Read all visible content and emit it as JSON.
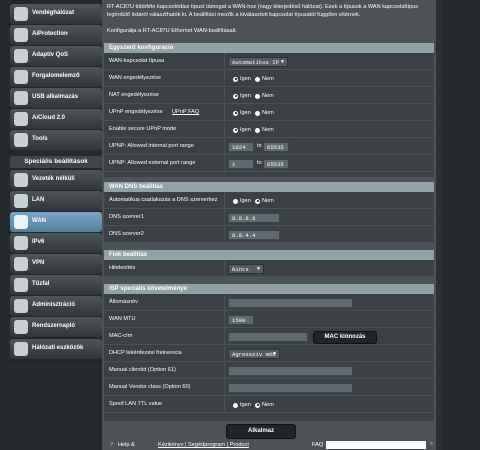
{
  "sidebar": {
    "general_items": [
      {
        "label": "Vendéghálózat",
        "icon": "guest-network-icon"
      },
      {
        "label": "AiProtection",
        "icon": "shield-icon"
      },
      {
        "label": "Adaptív QoS",
        "icon": "qos-icon"
      },
      {
        "label": "Forgalomelemző",
        "icon": "traffic-icon"
      },
      {
        "label": "USB alkalmazás",
        "icon": "usb-icon"
      },
      {
        "label": "AiCloud 2.0",
        "icon": "cloud-icon"
      },
      {
        "label": "Tools",
        "icon": "tools-icon"
      }
    ],
    "advanced_header": "Speciális beállítások",
    "advanced_items": [
      {
        "label": "Vezeték nélküli",
        "icon": "wireless-icon",
        "active": false
      },
      {
        "label": "LAN",
        "icon": "lan-icon",
        "active": false
      },
      {
        "label": "WAN",
        "icon": "wan-icon",
        "active": true
      },
      {
        "label": "IPv6",
        "icon": "ipv6-icon",
        "active": false
      },
      {
        "label": "VPN",
        "icon": "vpn-icon",
        "active": false
      },
      {
        "label": "Tűzfal",
        "icon": "firewall-icon",
        "active": false
      },
      {
        "label": "Adminisztráció",
        "icon": "admin-icon",
        "active": false
      },
      {
        "label": "Rendszernapló",
        "icon": "log-icon",
        "active": false
      },
      {
        "label": "Hálózati eszközök",
        "icon": "network-tools-icon",
        "active": false
      }
    ]
  },
  "main": {
    "intro": "RT-AC87U többféle kapcsolódási típust támogat a WAN-hoz (nagy kiterjedésű hálózat). Ezek a típusok a WAN kapcsolattípus legördülő listáról választhatók ki. A beállítási mezők a kiválasztott kapcsolat típusától függően eltérnek.",
    "intro2": "Konfigurálja a RT-AC87U Ethernet WAN-beállításait.",
    "basic": {
      "title": "Egyszerű konfiguráció",
      "wan_type_label": "WAN-kapcsolat típusa",
      "wan_type_value": "Automatikus IP",
      "wan_enable_label": "WAN engedélyezése",
      "nat_enable_label": "NAT engedélyezése",
      "upnp_enable_label": "UPnP engedélyezése",
      "upnp_faq": "UPnP FAQ",
      "secure_upnp_label": "Enable secure UPnP mode",
      "internal_range_label": "UPNP: Allowed internal port range",
      "internal_from": "1024",
      "internal_to": "65535",
      "external_range_label": "UPNP: Allowed external port range",
      "external_from": "1",
      "external_to": "65535",
      "to": "to",
      "yes": "Igen",
      "no": "Nem"
    },
    "dns": {
      "title": "WAN DNS beállítás",
      "auto_label": "Automatikus csatlakozás a DNS szerverhez",
      "dns1_label": "DNS szerver1",
      "dns1_value": "8.8.8.8",
      "dns2_label": "DNS szerver2",
      "dns2_value": "8.8.4.4"
    },
    "account": {
      "title": "Fiók beállítás",
      "auth_label": "Hitelesítés",
      "auth_value": "Nincs"
    },
    "isp": {
      "title": "ISP speciális követelménye",
      "host_label": "Állomásnév",
      "host_value": "",
      "mtu_label": "WAN MTU",
      "mtu_value": "1500",
      "mac_label": "MAC-cím",
      "mac_value": "",
      "mac_clone": "MAC klónozás",
      "dhcp_label": "DHCP lekérdezési frekvencia",
      "dhcp_value": "Agresszív mód",
      "clientid_label": "Manual clientid (Option 61)",
      "vendor_label": "Manual Vendor class (Option 60)",
      "ttl_label": "Spoof LAN TTL value"
    },
    "apply": "Alkalmaz"
  },
  "footer": {
    "help": "Help &",
    "links": "Kézikönyv | Segédprogram | Product",
    "faq": "FAQ"
  }
}
